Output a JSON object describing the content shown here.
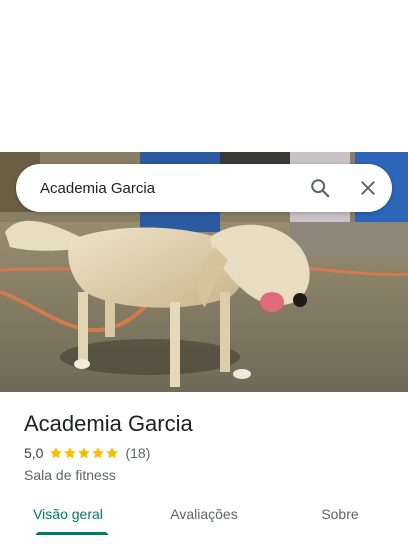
{
  "search": {
    "query": "Academia Garcia",
    "search_icon": "search-icon",
    "close_icon": "close-icon"
  },
  "place": {
    "name": "Academia Garcia",
    "rating": "5,0",
    "stars": 5,
    "review_count": "(18)",
    "category": "Sala de fitness"
  },
  "tabs": [
    {
      "label": "Visão geral",
      "active": true
    },
    {
      "label": "Avaliações",
      "active": false
    },
    {
      "label": "Sobre",
      "active": false
    }
  ],
  "colors": {
    "accent": "#00796b",
    "star": "#fbbc04",
    "text_primary": "#202124",
    "text_secondary": "#5f6368"
  }
}
